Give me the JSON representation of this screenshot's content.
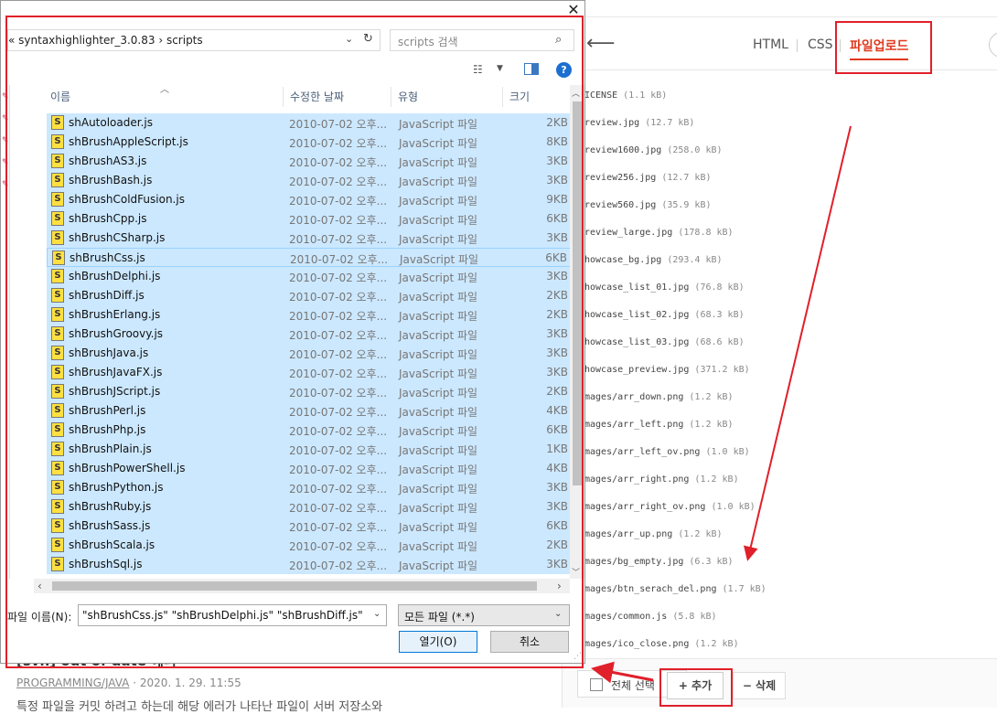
{
  "background_post": {
    "title": "[svn] out of date 에러",
    "category": "PROGRAMMING/JAVA",
    "date": "· 2020. 1. 29. 11:55",
    "body": "특정 파일을 커밋 하려고 하는데 해당 에러가 나타난 파일이 서버 저장소와"
  },
  "editor_panel": {
    "tabs": [
      {
        "label": "HTML"
      },
      {
        "label": "CSS"
      },
      {
        "label": "파일업로드"
      }
    ],
    "files": [
      {
        "name": "ICENSE",
        "size": "(1.1 kB)"
      },
      {
        "name": "review.jpg",
        "size": "(12.7 kB)"
      },
      {
        "name": "review1600.jpg",
        "size": "(258.0 kB)"
      },
      {
        "name": "review256.jpg",
        "size": "(12.7 kB)"
      },
      {
        "name": "review560.jpg",
        "size": "(35.9 kB)"
      },
      {
        "name": "review_large.jpg",
        "size": "(178.8 kB)"
      },
      {
        "name": "howcase_bg.jpg",
        "size": "(293.4 kB)"
      },
      {
        "name": "howcase_list_01.jpg",
        "size": "(76.8 kB)"
      },
      {
        "name": "howcase_list_02.jpg",
        "size": "(68.3 kB)"
      },
      {
        "name": "howcase_list_03.jpg",
        "size": "(68.6 kB)"
      },
      {
        "name": "howcase_preview.jpg",
        "size": "(371.2 kB)"
      },
      {
        "name": "mages/arr_down.png",
        "size": "(1.2 kB)"
      },
      {
        "name": "mages/arr_left.png",
        "size": "(1.2 kB)"
      },
      {
        "name": "mages/arr_left_ov.png",
        "size": "(1.0 kB)"
      },
      {
        "name": "mages/arr_right.png",
        "size": "(1.2 kB)"
      },
      {
        "name": "mages/arr_right_ov.png",
        "size": "(1.0 kB)"
      },
      {
        "name": "mages/arr_up.png",
        "size": "(1.2 kB)"
      },
      {
        "name": "mages/bg_empty.jpg",
        "size": "(6.3 kB)"
      },
      {
        "name": "mages/btn_serach_del.png",
        "size": "(1.7 kB)"
      },
      {
        "name": "mages/common.js",
        "size": "(5.8 kB)"
      },
      {
        "name": "mages/ico_close.png",
        "size": "(1.2 kB)"
      }
    ],
    "select_all_label": "전체 선택",
    "add_label": "+ 추가",
    "delete_label": "− 삭제"
  },
  "dialog": {
    "close_glyph": "✕",
    "breadcrumb": "« syntaxhighlighter_3.0.83  ›  scripts",
    "search_placeholder": "scripts 검색",
    "help_glyph": "?",
    "columns": {
      "name": "이름",
      "date": "수정한 날짜",
      "type": "유형",
      "size": "크기"
    },
    "files": [
      {
        "name": "shAutoloader.js",
        "date": "2010-07-02 오후...",
        "type": "JavaScript 파일",
        "size": "2KB"
      },
      {
        "name": "shBrushAppleScript.js",
        "date": "2010-07-02 오후...",
        "type": "JavaScript 파일",
        "size": "8KB"
      },
      {
        "name": "shBrushAS3.js",
        "date": "2010-07-02 오후...",
        "type": "JavaScript 파일",
        "size": "3KB"
      },
      {
        "name": "shBrushBash.js",
        "date": "2010-07-02 오후...",
        "type": "JavaScript 파일",
        "size": "3KB"
      },
      {
        "name": "shBrushColdFusion.js",
        "date": "2010-07-02 오후...",
        "type": "JavaScript 파일",
        "size": "9KB"
      },
      {
        "name": "shBrushCpp.js",
        "date": "2010-07-02 오후...",
        "type": "JavaScript 파일",
        "size": "6KB"
      },
      {
        "name": "shBrushCSharp.js",
        "date": "2010-07-02 오후...",
        "type": "JavaScript 파일",
        "size": "3KB"
      },
      {
        "name": "shBrushCss.js",
        "date": "2010-07-02 오후...",
        "type": "JavaScript 파일",
        "size": "6KB"
      },
      {
        "name": "shBrushDelphi.js",
        "date": "2010-07-02 오후...",
        "type": "JavaScript 파일",
        "size": "3KB"
      },
      {
        "name": "shBrushDiff.js",
        "date": "2010-07-02 오후...",
        "type": "JavaScript 파일",
        "size": "2KB"
      },
      {
        "name": "shBrushErlang.js",
        "date": "2010-07-02 오후...",
        "type": "JavaScript 파일",
        "size": "2KB"
      },
      {
        "name": "shBrushGroovy.js",
        "date": "2010-07-02 오후...",
        "type": "JavaScript 파일",
        "size": "3KB"
      },
      {
        "name": "shBrushJava.js",
        "date": "2010-07-02 오후...",
        "type": "JavaScript 파일",
        "size": "3KB"
      },
      {
        "name": "shBrushJavaFX.js",
        "date": "2010-07-02 오후...",
        "type": "JavaScript 파일",
        "size": "3KB"
      },
      {
        "name": "shBrushJScript.js",
        "date": "2010-07-02 오후...",
        "type": "JavaScript 파일",
        "size": "2KB"
      },
      {
        "name": "shBrushPerl.js",
        "date": "2010-07-02 오후...",
        "type": "JavaScript 파일",
        "size": "4KB"
      },
      {
        "name": "shBrushPhp.js",
        "date": "2010-07-02 오후...",
        "type": "JavaScript 파일",
        "size": "6KB"
      },
      {
        "name": "shBrushPlain.js",
        "date": "2010-07-02 오후...",
        "type": "JavaScript 파일",
        "size": "1KB"
      },
      {
        "name": "shBrushPowerShell.js",
        "date": "2010-07-02 오후...",
        "type": "JavaScript 파일",
        "size": "4KB"
      },
      {
        "name": "shBrushPython.js",
        "date": "2010-07-02 오후...",
        "type": "JavaScript 파일",
        "size": "3KB"
      },
      {
        "name": "shBrushRuby.js",
        "date": "2010-07-02 오후...",
        "type": "JavaScript 파일",
        "size": "3KB"
      },
      {
        "name": "shBrushSass.js",
        "date": "2010-07-02 오후...",
        "type": "JavaScript 파일",
        "size": "6KB"
      },
      {
        "name": "shBrushScala.js",
        "date": "2010-07-02 오후...",
        "type": "JavaScript 파일",
        "size": "2KB"
      },
      {
        "name": "shBrushSql.js",
        "date": "2010-07-02 오후...",
        "type": "JavaScript 파일",
        "size": "3KB"
      }
    ],
    "filename_label": "파일 이름(N):",
    "filename_value": "\"shBrushCss.js\" \"shBrushDelphi.js\" \"shBrushDiff.js\" \"shBrus",
    "filetype_value": "모든 파일 (*.*)",
    "open_label": "열기(O)",
    "cancel_label": "취소"
  },
  "colors": {
    "accent": "#e0391d",
    "annotation": "#e0202a",
    "selection": "#cce8ff",
    "dialog_primary": "#0078d7"
  }
}
